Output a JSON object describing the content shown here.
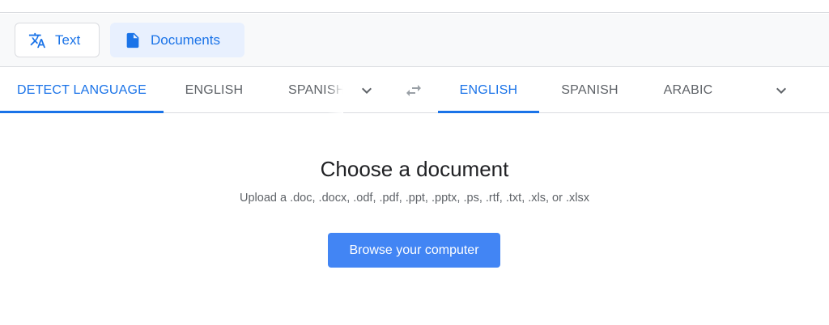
{
  "modes": {
    "text": {
      "label": "Text",
      "icon": "translate-icon"
    },
    "documents": {
      "label": "Documents",
      "icon": "document-icon"
    }
  },
  "source_languages": {
    "tabs": [
      {
        "label": "DETECT LANGUAGE",
        "active": true
      },
      {
        "label": "ENGLISH",
        "active": false
      },
      {
        "label": "SPANISH",
        "active": false
      }
    ],
    "more_icon": "chevron-down-icon"
  },
  "swap_icon": "swap-languages-icon",
  "target_languages": {
    "tabs": [
      {
        "label": "ENGLISH",
        "active": true
      },
      {
        "label": "SPANISH",
        "active": false
      },
      {
        "label": "ARABIC",
        "active": false
      }
    ],
    "more_icon": "chevron-down-icon"
  },
  "upload": {
    "title": "Choose a document",
    "subtitle": "Upload a .doc, .docx, .odf, .pdf, .ppt, .pptx, .ps, .rtf, .txt, .xls, or .xlsx",
    "button_label": "Browse your computer"
  },
  "colors": {
    "accent": "#1a73e8",
    "button": "#4285f4",
    "active_mode_bg": "#e8f0fe",
    "muted_text": "#5f6368"
  }
}
